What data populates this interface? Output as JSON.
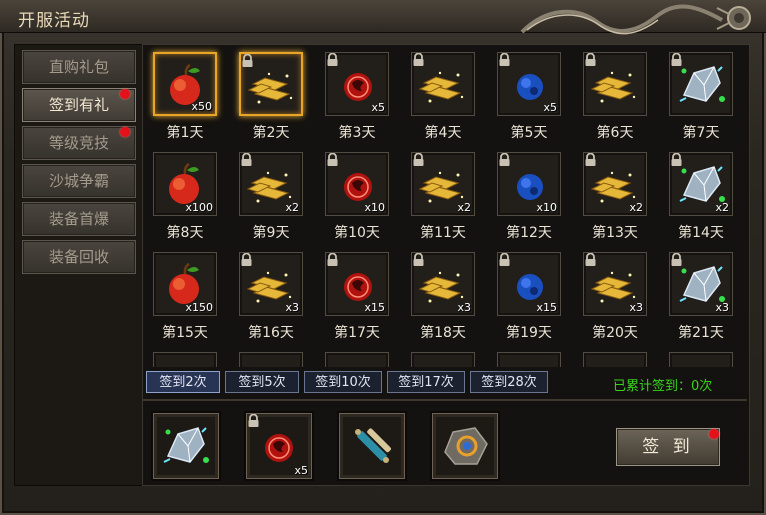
{
  "window": {
    "title": "开服活动"
  },
  "sidebar": {
    "items": [
      {
        "label": "直购礼包",
        "active": false,
        "dot": false
      },
      {
        "label": "签到有礼",
        "active": true,
        "dot": true
      },
      {
        "label": "等级竞技",
        "active": false,
        "dot": true
      },
      {
        "label": "沙城争霸",
        "active": false,
        "dot": false
      },
      {
        "label": "装备首爆",
        "active": false,
        "dot": false
      },
      {
        "label": "装备回收",
        "active": false,
        "dot": false
      }
    ]
  },
  "days": [
    {
      "label": "第1天",
      "item": "apple-icon",
      "qty": "x50",
      "locked": false,
      "glow": true
    },
    {
      "label": "第2天",
      "item": "gold-bars-icon",
      "qty": "",
      "locked": true,
      "glow": true
    },
    {
      "label": "第3天",
      "item": "red-orb-icon",
      "qty": "x5",
      "locked": true,
      "glow": false
    },
    {
      "label": "第4天",
      "item": "gold-bars-icon",
      "qty": "",
      "locked": true,
      "glow": false
    },
    {
      "label": "第5天",
      "item": "blue-orb-icon",
      "qty": "x5",
      "locked": true,
      "glow": false
    },
    {
      "label": "第6天",
      "item": "gold-bars-icon",
      "qty": "",
      "locked": true,
      "glow": false
    },
    {
      "label": "第7天",
      "item": "crystal-icon",
      "qty": "",
      "locked": true,
      "glow": false
    },
    {
      "label": "第8天",
      "item": "apple-icon",
      "qty": "x100",
      "locked": false,
      "glow": false
    },
    {
      "label": "第9天",
      "item": "gold-bars-icon",
      "qty": "x2",
      "locked": true,
      "glow": false
    },
    {
      "label": "第10天",
      "item": "red-orb-icon",
      "qty": "x10",
      "locked": true,
      "glow": false
    },
    {
      "label": "第11天",
      "item": "gold-bars-icon",
      "qty": "x2",
      "locked": true,
      "glow": false
    },
    {
      "label": "第12天",
      "item": "blue-orb-icon",
      "qty": "x10",
      "locked": true,
      "glow": false
    },
    {
      "label": "第13天",
      "item": "gold-bars-icon",
      "qty": "x2",
      "locked": true,
      "glow": false
    },
    {
      "label": "第14天",
      "item": "crystal-icon",
      "qty": "x2",
      "locked": true,
      "glow": false
    },
    {
      "label": "第15天",
      "item": "apple-icon",
      "qty": "x150",
      "locked": false,
      "glow": false
    },
    {
      "label": "第16天",
      "item": "gold-bars-icon",
      "qty": "x3",
      "locked": true,
      "glow": false
    },
    {
      "label": "第17天",
      "item": "red-orb-icon",
      "qty": "x15",
      "locked": true,
      "glow": false
    },
    {
      "label": "第18天",
      "item": "gold-bars-icon",
      "qty": "x3",
      "locked": true,
      "glow": false
    },
    {
      "label": "第19天",
      "item": "blue-orb-icon",
      "qty": "x15",
      "locked": true,
      "glow": false
    },
    {
      "label": "第20天",
      "item": "gold-bars-icon",
      "qty": "x3",
      "locked": true,
      "glow": false
    },
    {
      "label": "第21天",
      "item": "crystal-icon",
      "qty": "x3",
      "locked": true,
      "glow": false
    }
  ],
  "tabs": [
    {
      "label": "签到2次",
      "active": true
    },
    {
      "label": "签到5次",
      "active": false
    },
    {
      "label": "签到10次",
      "active": false
    },
    {
      "label": "签到17次",
      "active": false
    },
    {
      "label": "签到28次",
      "active": false
    }
  ],
  "cumulative": {
    "text": "已累计签到：0次"
  },
  "rewards": [
    {
      "item": "crystal-icon",
      "qty": "",
      "locked": false
    },
    {
      "item": "red-orb-icon",
      "qty": "x5",
      "locked": true
    },
    {
      "item": "scroll-icon",
      "qty": "",
      "locked": false
    },
    {
      "item": "ore-stone-icon",
      "qty": "",
      "locked": false
    }
  ],
  "sign_button": {
    "label": "签 到",
    "dot": true
  }
}
